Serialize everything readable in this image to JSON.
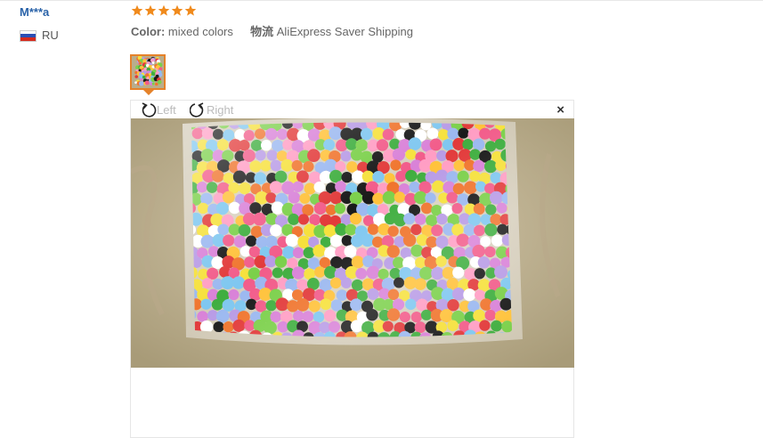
{
  "reviewer": {
    "name": "M***a",
    "country_code": "RU",
    "flag_colors": [
      "#ffffff",
      "#2b4fb5",
      "#d52b1e"
    ]
  },
  "rating": {
    "stars": 5,
    "max": 5,
    "color": "#f08a1c"
  },
  "meta": {
    "color_label": "Color:",
    "color_value": "mixed colors",
    "shipping_label": "物流",
    "shipping_value": "AliExpress Saver Shipping"
  },
  "viewer": {
    "rotate_left_label": "Left",
    "rotate_right_label": "Right",
    "close_label": "×"
  },
  "colors": {
    "accent": "#e5822a",
    "username": "#2962a8"
  },
  "image": {
    "subject": "clear plastic bag of multicolored pom-pom balls on a beige fabric surface"
  }
}
